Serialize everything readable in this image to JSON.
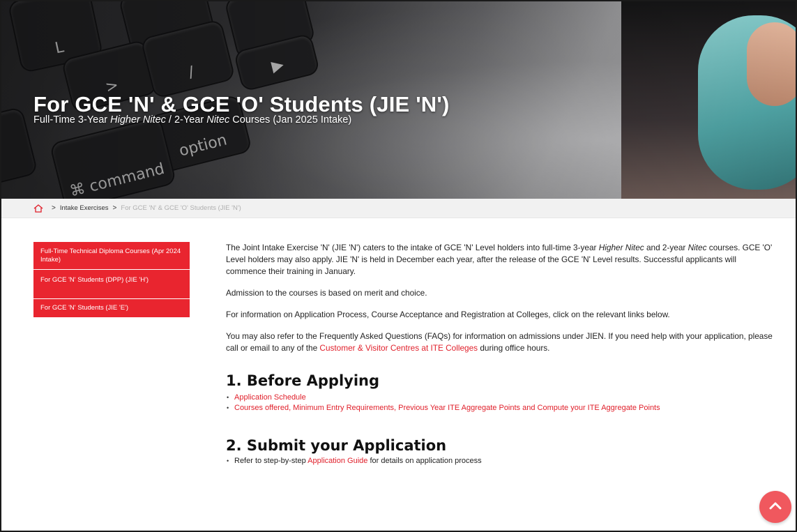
{
  "hero": {
    "title": "For GCE 'N' & GCE 'O' Students (JIE 'N')",
    "subtitle_pre": "Full-Time 3-Year ",
    "subtitle_em1": "Higher Nitec",
    "subtitle_mid": " / 2-Year ",
    "subtitle_em2": "Nitec",
    "subtitle_post": " Courses (Jan 2025 Intake)"
  },
  "breadcrumb": {
    "home_icon": "home-icon",
    "separator": ">",
    "items": [
      "Intake Exercises"
    ],
    "current": "For GCE 'N' & GCE 'O' Students (JIE 'N')"
  },
  "sidebar": {
    "items": [
      {
        "label": "Full-Time Technical Diploma Courses (Apr 2024 Intake)"
      },
      {
        "label": "For GCE 'N' Students (DPP) (JIE 'H')"
      },
      {
        "label": "For GCE 'N' Students (JIE 'E')"
      }
    ],
    "color": "#e9252f"
  },
  "main": {
    "intro": {
      "t1": "The Joint Intake Exercise 'N' (JIE 'N') caters to the intake of GCE 'N' Level holders into full-time 3-year ",
      "em1": "Higher Nitec",
      "t2": " and 2-year ",
      "em2": "Nitec",
      "t3": " courses. GCE 'O' Level holders may also apply. JIE 'N' is held in December each year, after the release of the GCE 'N' Level results. Successful applicants will commence their training in January."
    },
    "para2": "Admission to the courses is based on merit and choice.",
    "para3": "For information on Application Process, Course Acceptance and Registration at Colleges, click on the relevant links below.",
    "para4": {
      "t1": "You may also refer to the Frequently Asked Questions (FAQs) for information on admissions under JIEN. If you need help with your application, please call or email to any of the ",
      "link": "Customer & Visitor Centres at ITE Colleges",
      "t2": " during office hours."
    },
    "section1": {
      "heading": "1. Before Applying",
      "links": [
        "Application Schedule",
        "Courses offered, Minimum Entry Requirements, Previous Year ITE Aggregate Points and Compute your ITE Aggregate Points"
      ]
    },
    "section2": {
      "heading": "2. Submit your Application",
      "item_pre": "Refer to step-by-step ",
      "item_link": "Application Guide",
      "item_post": " for details on application process"
    },
    "link_color": "#e0202b"
  },
  "back_to_top": {
    "icon": "chevron-up-icon",
    "color": "#f0585e"
  }
}
